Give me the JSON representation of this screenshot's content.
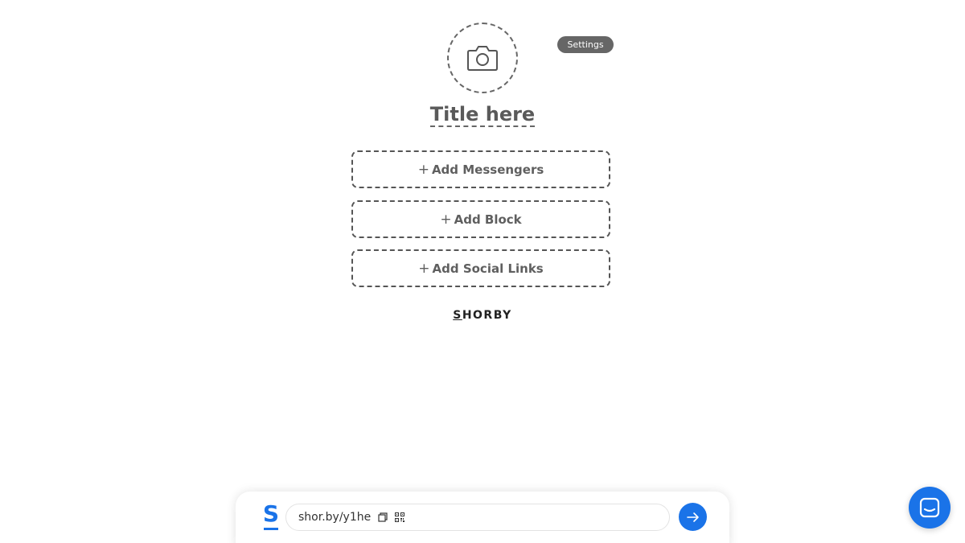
{
  "header": {
    "settings_label": "Settings"
  },
  "profile": {
    "title": "Title here",
    "avatar_icon": "camera-icon"
  },
  "blocks": {
    "add_messengers": "Add Messengers",
    "add_block": "Add Block",
    "add_social_links": "Add Social Links",
    "plus_glyph": "+"
  },
  "brand": {
    "first_letter": "S",
    "rest": "HORBY"
  },
  "bottom_bar": {
    "logo_letter": "S",
    "url": "shor.by/y1he",
    "copy_icon": "copy-icon",
    "qr_icon": "qr-code-icon",
    "go_icon": "arrow-right-icon"
  },
  "chat": {
    "icon": "chat-icon"
  },
  "colors": {
    "accent": "#1a73e8",
    "muted": "#666666",
    "text": "#555555"
  }
}
